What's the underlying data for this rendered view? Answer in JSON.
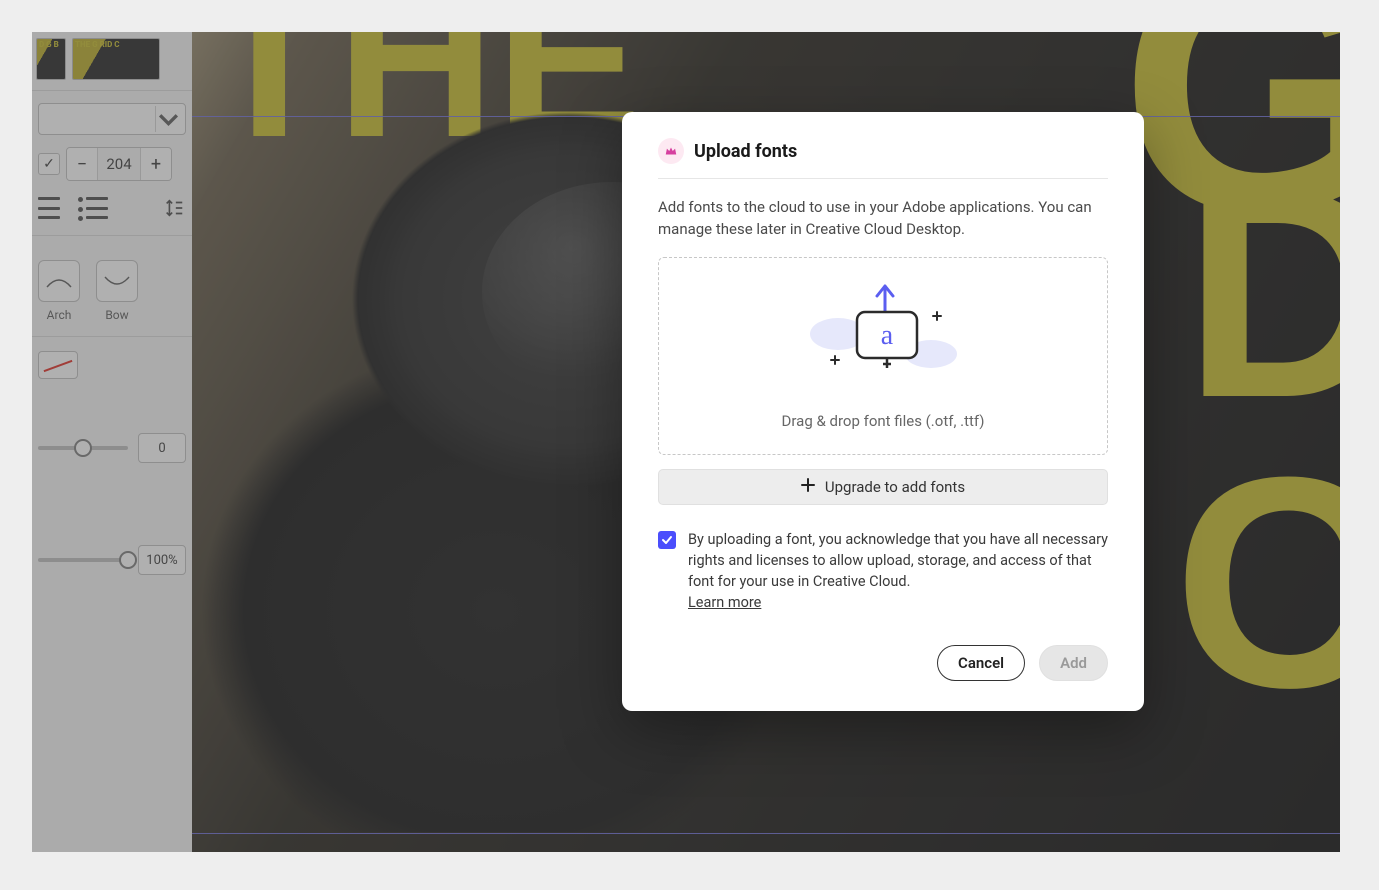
{
  "canvas": {
    "big_text_fragments": [
      "THE",
      "G",
      "D",
      "C"
    ],
    "thumb_labels": [
      "D G B",
      "THE G RID C"
    ]
  },
  "sidepanel": {
    "font_size": "204",
    "shapes": [
      {
        "label": "Arch"
      },
      {
        "label": "Bow"
      }
    ],
    "letter_spacing_value": "0",
    "opacity_value": "100%"
  },
  "modal": {
    "title": "Upload fonts",
    "description": "Add fonts to the cloud to use in your Adobe applications. You can manage these later in Creative Cloud Desktop.",
    "dropzone_text": "Drag & drop font files (.otf, .ttf)",
    "upgrade_label": "Upgrade to add fonts",
    "acknowledge_text": "By uploading a font, you acknowledge that you have all necessary rights and licenses to allow upload, storage, and access of that font for your use in Creative Cloud.",
    "learn_more_label": "Learn more",
    "acknowledge_checked": true,
    "cancel_label": "Cancel",
    "add_label": "Add"
  }
}
